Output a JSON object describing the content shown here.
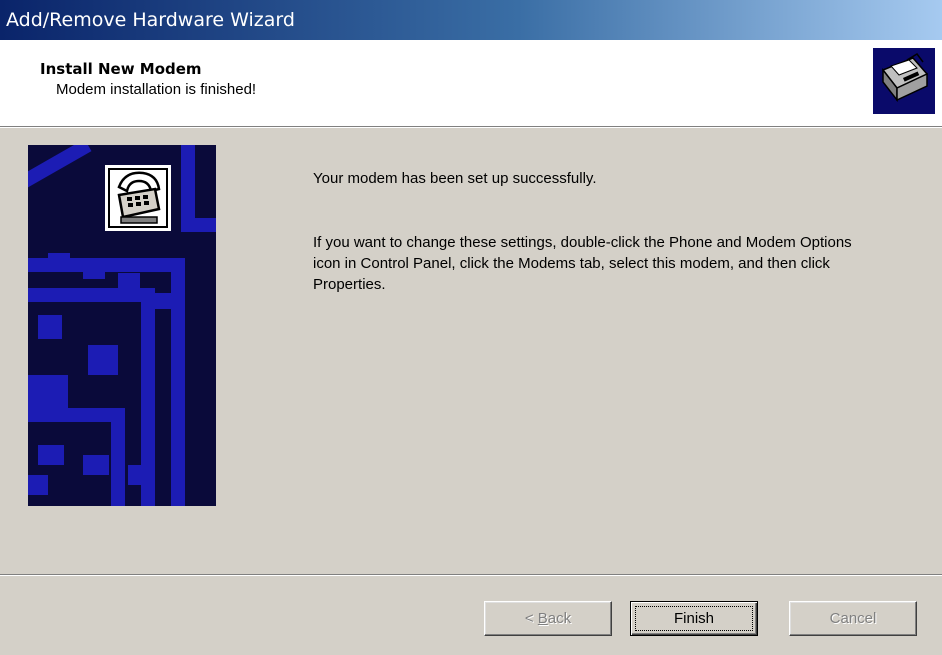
{
  "window": {
    "title": "Add/Remove Hardware Wizard"
  },
  "header": {
    "title": "Install New Modem",
    "subtitle": "Modem installation is finished!",
    "icon": "hardware-wizard-icon"
  },
  "side_art": {
    "icon": "telephone-icon"
  },
  "body": {
    "message": "Your modem has been set up successfully.",
    "instructions": "If you want to change these settings, double-click the Phone and Modem Options icon in Control Panel, click the Modems tab, select this modem, and then click Properties."
  },
  "buttons": {
    "back_prefix": "< ",
    "back_accel": "B",
    "back_rest": "ack",
    "finish": "Finish",
    "cancel": "Cancel"
  },
  "colors": {
    "titlebar_start": "#0a246a",
    "titlebar_end": "#a6caf0",
    "dialog_bg": "#d4d0c8",
    "art_dark": "#0a0a3a",
    "art_blue": "#1c1cb4"
  }
}
